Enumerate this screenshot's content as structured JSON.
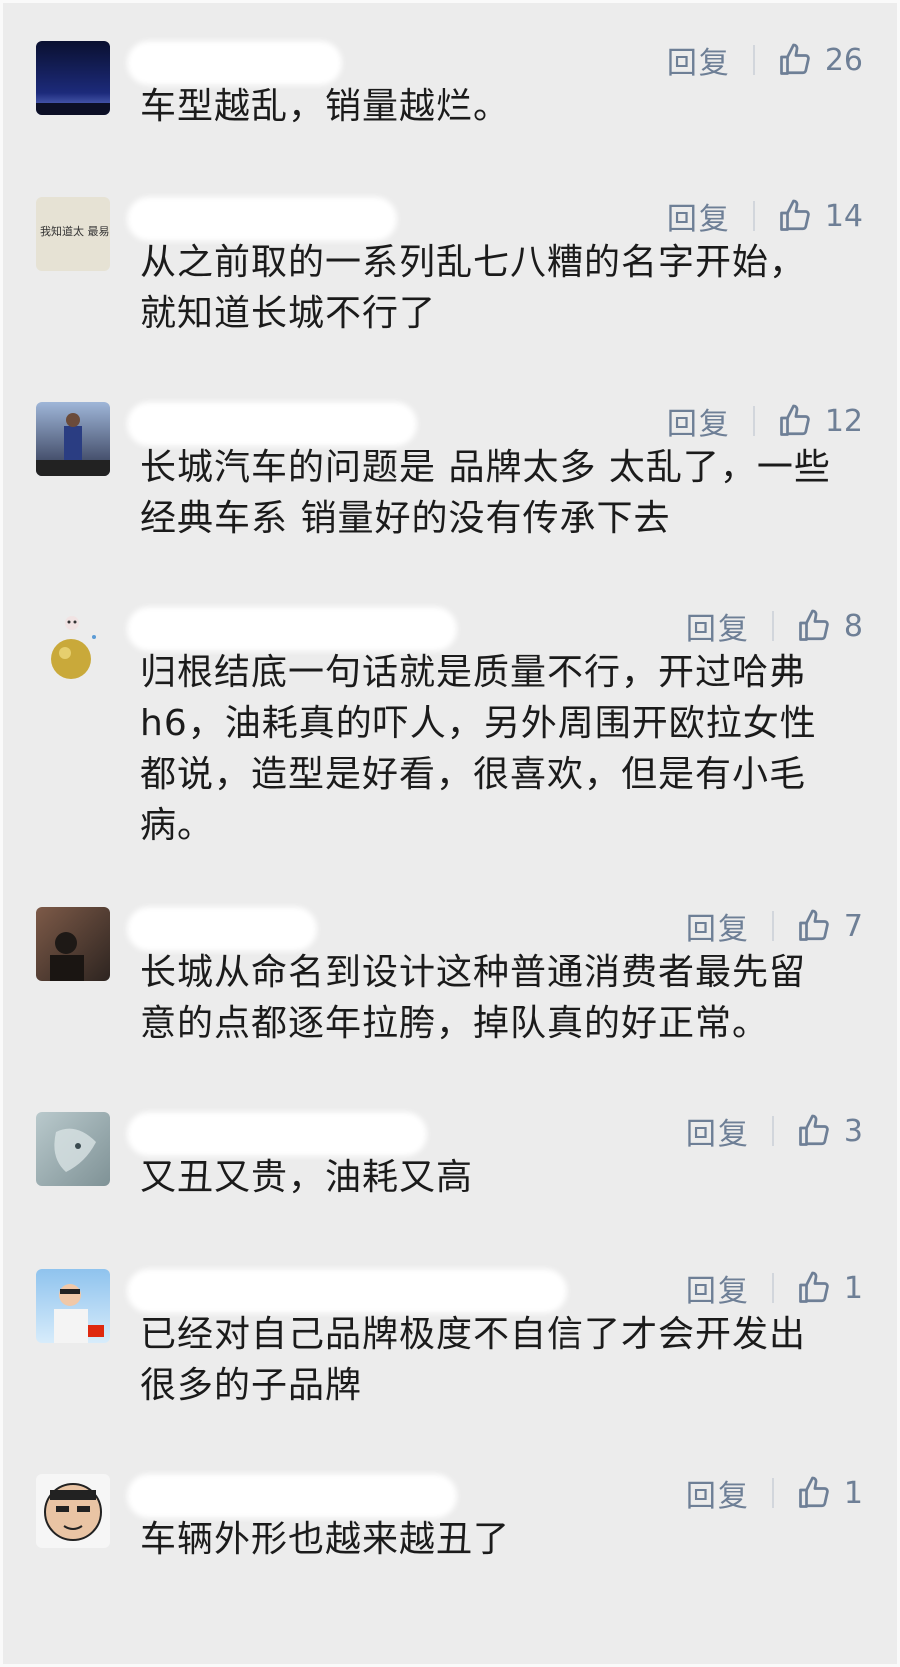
{
  "reply_label": "回复",
  "comments": [
    {
      "text": "车型越乱，销量越烂。",
      "likes": "26"
    },
    {
      "text": "从之前取的一系列乱七八糟的名字开始，\n就知道长城不行了",
      "likes": "14"
    },
    {
      "text": "长城汽车的问题是 品牌太多 太乱了，一些\n经典车系 销量好的没有传承下去",
      "likes": "12"
    },
    {
      "text": "归根结底一句话就是质量不行，开过哈弗\nh6，油耗真的吓人，另外周围开欧拉女性\n都说，造型是好看，很喜欢，但是有小毛\n病。",
      "likes": "8"
    },
    {
      "text": "长城从命名到设计这种普通消费者最先留\n意的点都逐年拉胯，掉队真的好正常。",
      "likes": "7"
    },
    {
      "text": "又丑又贵，油耗又高",
      "likes": "3"
    },
    {
      "text": "已经对自己品牌极度不自信了才会开发出\n很多的子品牌",
      "likes": "1"
    },
    {
      "text": "车辆外形也越来越丑了",
      "likes": "1"
    }
  ],
  "avatar_caption": "我知道太 最易梁园",
  "colors": {
    "background": "#ececec",
    "meta": "#6e7f96",
    "text": "#1b1b1b"
  },
  "icons": {
    "like": "thumbs-up-icon"
  }
}
